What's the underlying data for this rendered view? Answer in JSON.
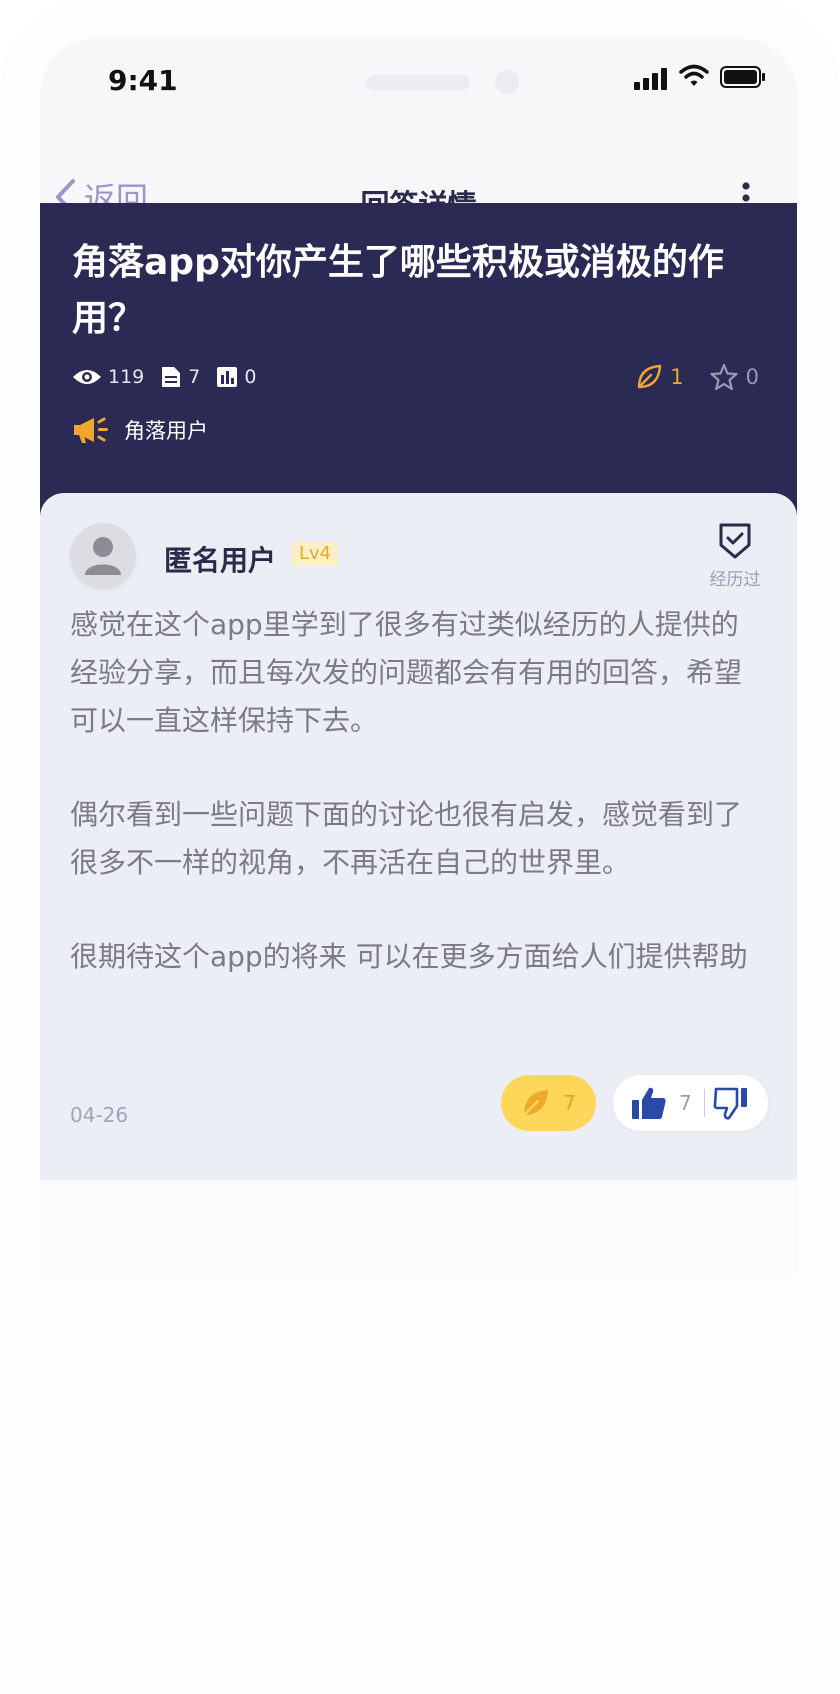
{
  "status_bar": {
    "time": "9:41"
  },
  "nav": {
    "back_label": "返回",
    "title": "回答详情"
  },
  "question": {
    "title": "角落app对你产生了哪些积极或消极的作用？",
    "views": "119",
    "answers": "7",
    "stats": "0",
    "leaves": "1",
    "favorites": "0",
    "tag": "角落用户"
  },
  "answer": {
    "user_name": "匿名用户",
    "level": "Lv4",
    "experienced_label": "经历过",
    "paragraphs": [
      "感觉在这个app里学到了很多有过类似经历的人提供的经验分享，而且每次发的问题都会有有用的回答，希望可以一直这样保持下去。",
      "偶尔看到一些问题下面的讨论也很有启发，感觉看到了很多不一样的视角，不再活在自己的世界里。",
      "很期待这个app的将来 可以在更多方面给人们提供帮助"
    ],
    "date": "04-26",
    "leaf_count": "7",
    "like_count": "7"
  },
  "colors": {
    "header_bg": "#2a2a55",
    "accent_orange": "#f0a72d",
    "leaf_button": "#fdd65a",
    "thumb_blue": "#2b4aa8",
    "card_bg": "#eceef5"
  },
  "icons": [
    "signal-icon",
    "wifi-icon",
    "battery-icon",
    "back-chevron-icon",
    "more-icon",
    "eye-icon",
    "document-icon",
    "chart-icon",
    "leaf-icon",
    "star-icon",
    "megaphone-icon",
    "avatar-icon",
    "badge-check-icon",
    "thumbs-up-icon",
    "thumbs-down-icon"
  ]
}
